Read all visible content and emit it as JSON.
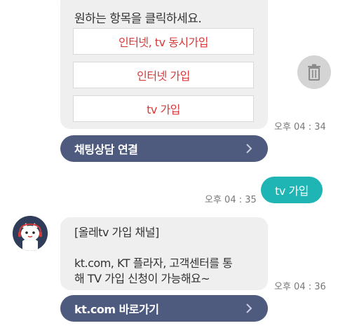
{
  "bot_message_1": {
    "prompt": "원하는 항목을 클릭하세요.",
    "options": [
      "인터넷, tv 동시가입",
      "인터넷 가입",
      "tv 가입"
    ],
    "time": "오후 04 : 34"
  },
  "action_1": {
    "label": "채팅상담 연결"
  },
  "user_message": {
    "text": "tv 가입",
    "time": "오후 04 : 35"
  },
  "bot_message_2": {
    "title": "[올레tv 가입 채널]",
    "body_line1": "kt.com, KT 플라자, 고객센터를 통",
    "body_line2": "해 TV 가입 신청이 가능해요~",
    "time": "오후 04 : 36"
  },
  "action_2": {
    "label": "kt.com 바로가기"
  },
  "icons": {
    "delete": "trash-icon",
    "chevron": "chevron-right-icon",
    "avatar": "bot-avatar"
  },
  "colors": {
    "accent_teal": "#1fb5b5",
    "action_navy": "#4e5a7e",
    "option_red": "#d63a3a"
  }
}
